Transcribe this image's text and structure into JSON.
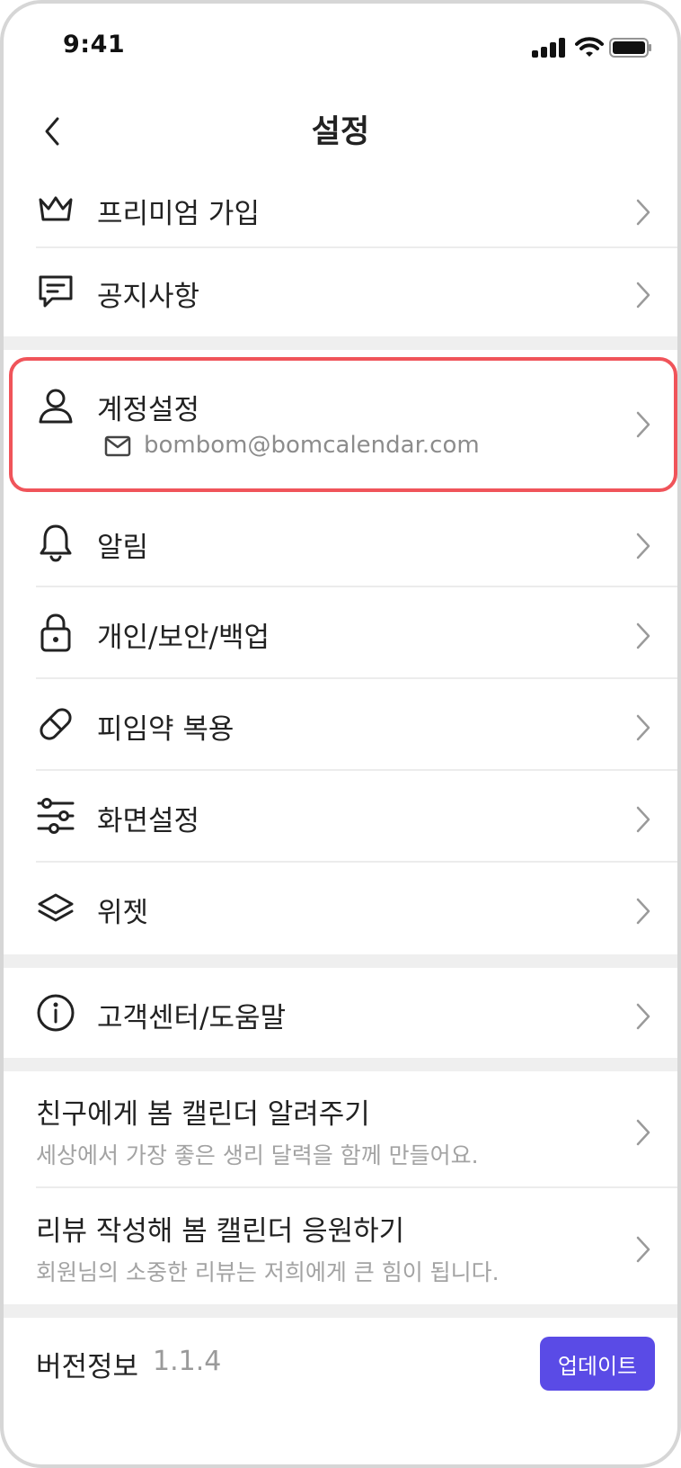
{
  "status_bar": {
    "time": "9:41"
  },
  "nav": {
    "title": "설정"
  },
  "menu": {
    "premium": "프리미엄 가입",
    "notice": "공지사항",
    "account": "계정설정",
    "account_email": "bombom@bomcalendar.com",
    "alarm": "알림",
    "privacy": "개인/보안/백업",
    "pill": "피임약 복용",
    "display": "화면설정",
    "widget": "위젯",
    "help": "고객센터/도움말"
  },
  "promos": [
    {
      "title": "친구에게 봄 캘린더 알려주기",
      "subtitle": "세상에서 가장 좋은 생리 달력을 함께 만들어요."
    },
    {
      "title": "리뷰 작성해 봄 캘린더 응원하기",
      "subtitle": "회원님의 소중한 리뷰는 저희에게 큰 힘이 됩니다."
    }
  ],
  "version": {
    "label": "버전정보",
    "number": "1.1.4",
    "update_label": "업데이트"
  },
  "colors": {
    "accent": "#5a4be6",
    "highlight": "#f0545a",
    "divider": "#ececec",
    "section_gap": "#efefef"
  }
}
